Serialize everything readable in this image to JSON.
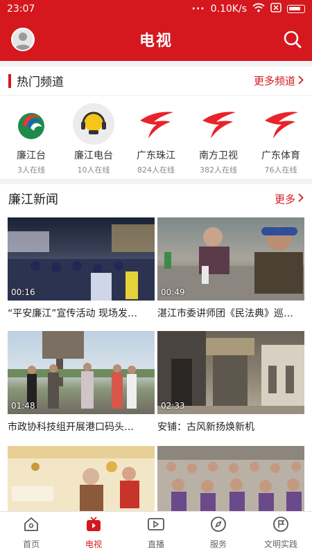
{
  "status_bar": {
    "time": "23:07",
    "signal_dots": "···",
    "speed": "0.10K/s"
  },
  "header": {
    "title": "电视"
  },
  "hot_channels": {
    "title": "热门频道",
    "more": "更多频道",
    "items": [
      {
        "name": "廉江台",
        "online": "3人在线",
        "logo": "lianjiang-tv-logo"
      },
      {
        "name": "廉江电台",
        "online": "10人在线",
        "logo": "lianjiang-radio-logo"
      },
      {
        "name": "广东珠江",
        "online": "824人在线",
        "logo": "guangdong-tv-logo"
      },
      {
        "name": "南方卫视",
        "online": "382人在线",
        "logo": "guangdong-tv-logo"
      },
      {
        "name": "广东体育",
        "online": "76人在线",
        "logo": "guangdong-tv-logo"
      }
    ]
  },
  "news": {
    "title": "廉江新闻",
    "more": "更多",
    "items": [
      {
        "duration": "00:16",
        "caption": "“平安廉江”宣传活动 现场发…"
      },
      {
        "duration": "00:49",
        "caption": "湛江市委讲师团《民法典》巡…"
      },
      {
        "duration": "01:48",
        "caption": "市政协科技组开展港口码头…"
      },
      {
        "duration": "02:33",
        "caption": "安铺：古风新扬焕新机"
      },
      {
        "duration": "",
        "caption": ""
      },
      {
        "duration": "",
        "caption": ""
      }
    ]
  },
  "tabs": [
    {
      "label": "首页",
      "icon": "home-icon"
    },
    {
      "label": "电视",
      "icon": "tv-icon",
      "active": true
    },
    {
      "label": "直播",
      "icon": "live-video-icon"
    },
    {
      "label": "服务",
      "icon": "compass-icon"
    },
    {
      "label": "文明实践",
      "icon": "flag-icon"
    }
  ],
  "colors": {
    "brand": "#d4181e",
    "background": "#f2f2f2"
  }
}
